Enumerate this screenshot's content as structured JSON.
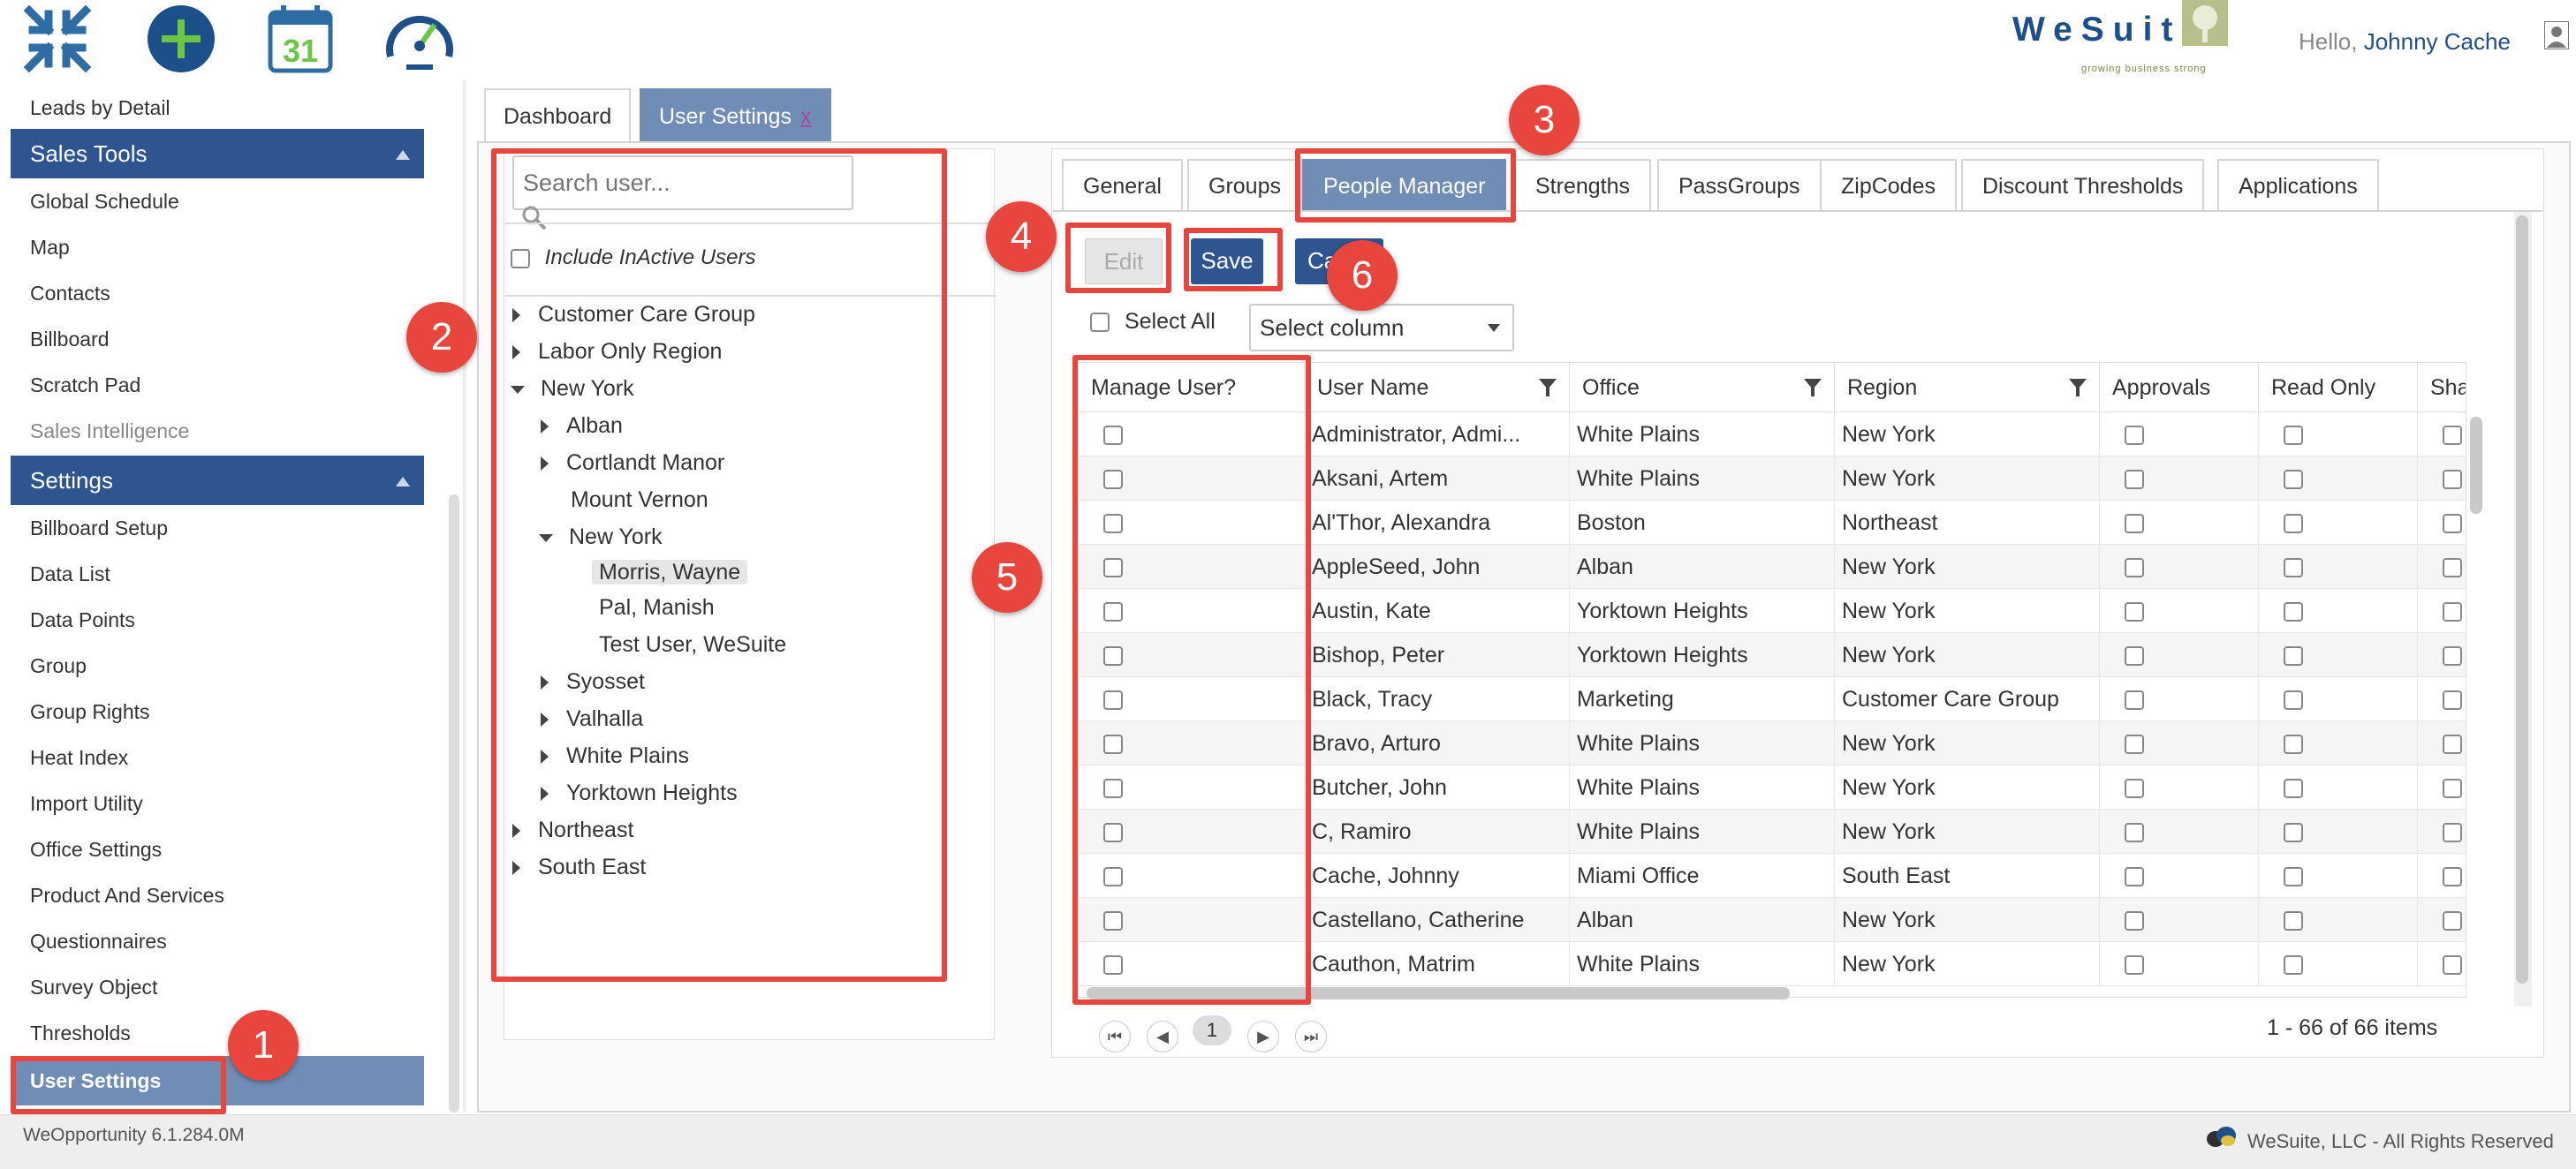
{
  "header": {
    "brand": "WeSuite",
    "tagline": "growing business strong",
    "greeting": "Hello,",
    "user_name": "Johnny Cache",
    "icons": [
      "collapse-arrows-icon",
      "add-circle-icon",
      "calendar-icon",
      "speedometer-icon",
      "logo-tree-icon",
      "user-avatar-icon"
    ],
    "calendar_day": "31"
  },
  "sidebar": {
    "top_item": "Leads by Detail",
    "sales_tools_header": "Sales Tools",
    "sales_tools": [
      "Global Schedule",
      "Map",
      "Contacts",
      "Billboard",
      "Scratch Pad",
      "Sales Intelligence"
    ],
    "settings_header": "Settings",
    "settings": [
      "Billboard Setup",
      "Data List",
      "Data Points",
      "Group",
      "Group Rights",
      "Heat Index",
      "Import Utility",
      "Office Settings",
      "Product And Services",
      "Questionnaires",
      "Survey Object",
      "Thresholds",
      "User Settings"
    ]
  },
  "main_tabs": [
    {
      "label": "Dashboard"
    },
    {
      "label": "User Settings",
      "close": "x"
    }
  ],
  "user_tree": {
    "search_placeholder": "Search user...",
    "include_inactive_label": "Include InActive Users",
    "nodes": [
      "Customer Care Group",
      "Labor Only Region",
      "New York",
      "Alban",
      "Cortlandt Manor",
      "Mount Vernon",
      "New York",
      "Morris, Wayne",
      "Pal, Manish",
      "Test User, WeSuite",
      "Syosset",
      "Valhalla",
      "White Plains",
      "Yorktown Heights",
      "Northeast",
      "South East"
    ]
  },
  "sub_tabs": [
    "General",
    "Groups",
    "People Manager",
    "Strengths",
    "PassGroups",
    "ZipCodes",
    "Discount Thresholds",
    "Applications"
  ],
  "actions": {
    "edit": "Edit",
    "save": "Save",
    "cancel": "Ca",
    "select_all": "Select All",
    "select_column": "Select column"
  },
  "grid": {
    "columns": [
      "Manage User?",
      "User Name",
      "Office",
      "Region",
      "Approvals",
      "Read Only",
      "Sha"
    ],
    "rows": [
      [
        "Administrator, Admi...",
        "White Plains",
        "New York"
      ],
      [
        "Aksani, Artem",
        "White Plains",
        "New York"
      ],
      [
        "Al'Thor, Alexandra",
        "Boston",
        "Northeast"
      ],
      [
        "AppleSeed, John",
        "Alban",
        "New York"
      ],
      [
        "Austin, Kate",
        "Yorktown Heights",
        "New York"
      ],
      [
        "Bishop, Peter",
        "Yorktown Heights",
        "New York"
      ],
      [
        "Black, Tracy",
        "Marketing",
        "Customer Care Group"
      ],
      [
        "Bravo, Arturo",
        "White Plains",
        "New York"
      ],
      [
        "Butcher, John",
        "White Plains",
        "New York"
      ],
      [
        "C, Ramiro",
        "White Plains",
        "New York"
      ],
      [
        "Cache, Johnny",
        "Miami Office",
        "South East"
      ],
      [
        "Castellano, Catherine",
        "Alban",
        "New York"
      ],
      [
        "Cauthon, Matrim",
        "White Plains",
        "New York"
      ]
    ]
  },
  "pager": {
    "page": "1",
    "info": "1 - 66 of 66 items",
    "first": "⏮",
    "prev": "◀",
    "next": "▶",
    "last": "⏭"
  },
  "footer": {
    "version": "WeOpportunity 6.1.284.0M",
    "copyright": "WeSuite, LLC - All Rights Reserved"
  },
  "callouts": [
    "1",
    "2",
    "3",
    "4",
    "5",
    "6"
  ],
  "colors": {
    "accent": "#2f5590",
    "selected": "#6f8db5",
    "callout": "#e8453c"
  }
}
